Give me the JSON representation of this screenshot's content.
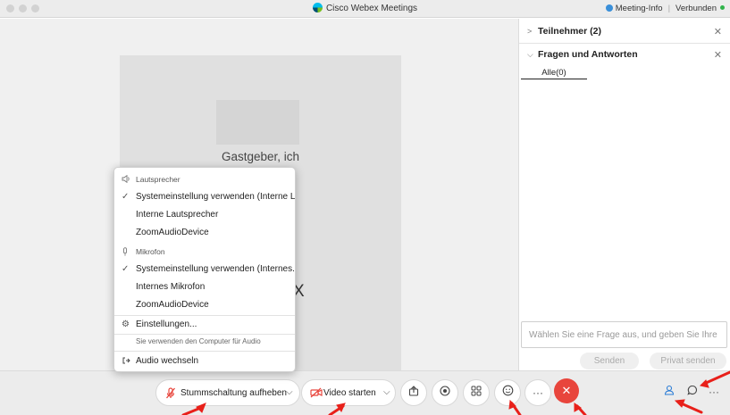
{
  "window": {
    "title": "Cisco Webex Meetings",
    "meeting_info": "Meeting-Info",
    "status": "Verbunden"
  },
  "video": {
    "host_name": "Gastgeber, ich",
    "tile2_text": "X"
  },
  "panel": {
    "participants_title": "Teilnehmer (2)",
    "qa_title": "Fragen und Antworten",
    "qa_tab": "Alle(0)",
    "qa_input_placeholder": "Wählen Sie eine Frage aus, und geben Sie Ihre",
    "send_label": "Senden",
    "send_private_label": "Privat senden"
  },
  "audio_menu": {
    "speaker_header": "Lautsprecher",
    "speaker_items": [
      "Systemeinstellung verwenden (Interne La...",
      "Interne Lautsprecher",
      "ZoomAudioDevice"
    ],
    "mic_header": "Mikrofon",
    "mic_items": [
      "Systemeinstellung verwenden (Internes...",
      "Internes Mikrofon",
      "ZoomAudioDevice"
    ],
    "settings_label": "Einstellungen...",
    "note": "Sie verwenden den Computer für Audio",
    "switch_audio_label": "Audio wechseln",
    "selected_speaker_index": 0,
    "selected_mic_index": 0
  },
  "toolbar": {
    "unmute_label": "Stummschaltung aufheben",
    "start_video_label": "Video starten"
  },
  "colors": {
    "end_call": "#e8453c",
    "annotation_arrow": "#e8201a",
    "muted_icon": "#e8453c"
  },
  "icons": {
    "speaker": "speaker-icon",
    "check": "check-icon",
    "mic": "mic-icon",
    "gear": "gear-icon",
    "switch": "switch-audio-icon",
    "share": "share-icon",
    "record": "record-icon",
    "apps": "apps-icon",
    "reactions": "reactions-icon",
    "more": "more-icon",
    "end": "end-call-icon",
    "participants": "participants-icon",
    "chat": "chat-icon"
  }
}
